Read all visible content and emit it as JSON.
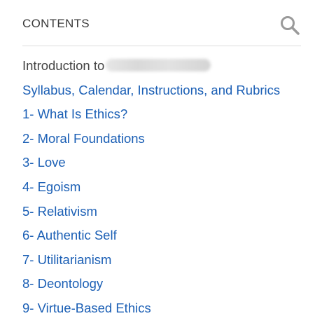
{
  "header": {
    "title": "CONTENTS",
    "search_icon": "search-icon"
  },
  "toc": {
    "intro_label": "Introduction to",
    "items": [
      "Syllabus, Calendar, Instructions, and Rubrics",
      "1- What Is Ethics?",
      "2- Moral Foundations",
      "3- Love",
      "4- Egoism",
      "5- Relativism",
      "6- Authentic Self",
      "7- Utilitarianism",
      "8- Deontology",
      "9- Virtue-Based Ethics"
    ]
  },
  "colors": {
    "link": "#1b5fb5",
    "heading": "#3a3a3a",
    "intro_text": "#444444",
    "divider": "#dcdcdc",
    "icon": "#9a9a9a"
  }
}
